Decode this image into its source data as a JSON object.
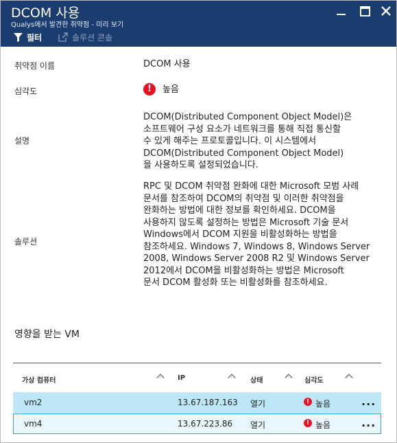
{
  "window": {
    "title": "DCOM 사용",
    "subtitle": "Qualys에서 발견한 취약점 - 미리 보기",
    "toolbar": {
      "filter_label": "필터",
      "console_label": "솔루션 콘솔"
    }
  },
  "details": {
    "name_label": "취약점 이름",
    "name_value": "DCOM 사용",
    "severity_label": "심각도",
    "severity_value": "높음",
    "description_label": "설명",
    "description_lines": [
      "DCOM(Distributed Component Object Model)은",
      "소프트웨어 구성 요소가 네트워크를 통해 직접 통신할",
      "수 있게 해주는 프로토콜입니다. 이 시스템에서",
      "DCOM(Distributed Component Object Model)",
      "을 사용하도록 설정되었습니다."
    ],
    "solution_label": "솔루션",
    "solution_lines": [
      "RPC 및 DCOM 취약점 완화에 대한 Microsoft 모범 사례",
      "문서를 참조하여 DCOM의 취약점 및 이러한 취약점을",
      "완화하는 방법에 대한 정보를 확인하세요. DCOM을",
      "사용하지 않도록 설정하는 방법은 Microsoft 기술 문서",
      "Windows에서 DCOM 지원을 비활성화하는 방법을",
      "참조하세요. Windows 7, Windows 8, Windows Server",
      "2008, Windows Server 2008 R2 및 Windows Server",
      "2012에서 DCOM을 비활성화하는 방법은 Microsoft",
      "문서 DCOM 활성화 또는 비활성화를 참조하세요."
    ]
  },
  "affected": {
    "title": "영향을 받는 VM",
    "columns": {
      "vm": "가상 컴퓨터",
      "ip": "IP",
      "state": "상태",
      "severity": "심각도"
    },
    "rows": [
      {
        "vm": "vm2",
        "ip": "13.67.187.163",
        "state": "열기",
        "severity": "높음",
        "more": "..."
      },
      {
        "vm": "vm4",
        "ip": "13.67.223.86",
        "state": "열기",
        "severity": "높음",
        "more": "..."
      }
    ]
  },
  "colors": {
    "titlebar": "#1b3c6e",
    "severity_high": "#e81123",
    "selected_row": "#bde7f7",
    "focus_border": "#3a9bd8"
  }
}
